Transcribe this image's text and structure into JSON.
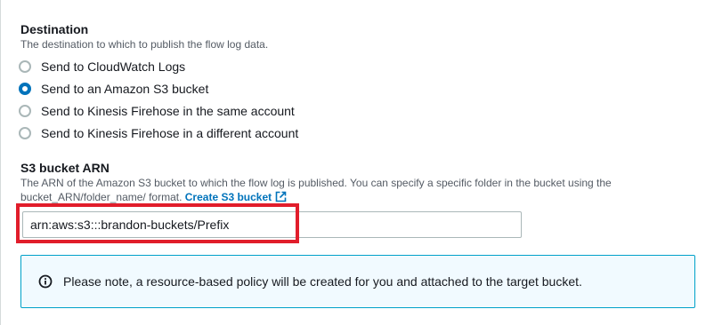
{
  "destination": {
    "title": "Destination",
    "description": "The destination to which to publish the flow log data.",
    "options": [
      {
        "label": "Send to CloudWatch Logs",
        "selected": false
      },
      {
        "label": "Send to an Amazon S3 bucket",
        "selected": true
      },
      {
        "label": "Send to Kinesis Firehose in the same account",
        "selected": false
      },
      {
        "label": "Send to Kinesis Firehose in a different account",
        "selected": false
      }
    ]
  },
  "s3_bucket_arn": {
    "title": "S3 bucket ARN",
    "description_line1": "The ARN of the Amazon S3 bucket to which the flow log is published. You can specify a specific folder in the bucket using the",
    "description_line2": "bucket_ARN/folder_name/ format.",
    "create_link_label": "Create S3 bucket",
    "value": "arn:aws:s3:::brandon-buckets/Prefix"
  },
  "notice": {
    "text": "Please note, a resource-based policy will be created for you and attached to the target bucket."
  },
  "colors": {
    "accent": "#0073bb",
    "highlight": "#e11d2b",
    "info_border": "#00a1c9",
    "info_background": "#f1faff"
  },
  "icons": {
    "external_link": "external-link-icon",
    "info": "info-icon"
  }
}
